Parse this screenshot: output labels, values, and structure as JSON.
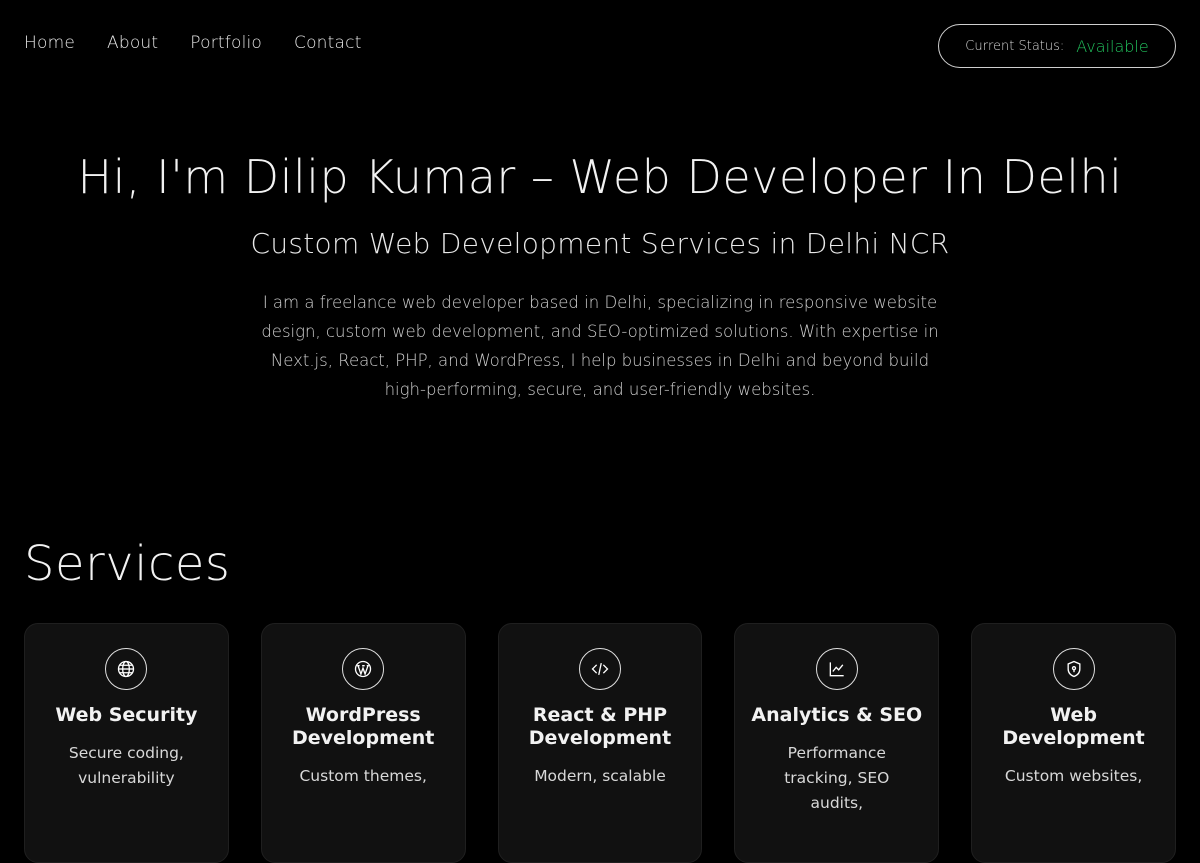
{
  "nav": {
    "links": [
      "Home",
      "About",
      "Portfolio",
      "Contact"
    ],
    "status_label": "Current Status:",
    "status_value": "Available"
  },
  "hero": {
    "title": "Hi, I'm Dilip Kumar – Web Developer In Delhi",
    "subtitle": "Custom Web Development Services in Delhi NCR",
    "description": "I am a freelance web developer based in Delhi, specializing in responsive website design, custom web development, and SEO-optimized solutions. With expertise in Next.js, React, PHP, and WordPress, I help businesses in Delhi and beyond build high-performing, secure, and user-friendly websites."
  },
  "services": {
    "title": "Services",
    "cards": [
      {
        "icon": "globe-icon",
        "title": "Web Security",
        "desc": "Secure coding, vulnerability"
      },
      {
        "icon": "wordpress-icon",
        "title": "WordPress Development",
        "desc": "Custom themes,"
      },
      {
        "icon": "code-icon",
        "title": "React & PHP Development",
        "desc": "Modern, scalable"
      },
      {
        "icon": "chart-icon",
        "title": "Analytics & SEO",
        "desc": "Performance tracking, SEO audits,"
      },
      {
        "icon": "shield-icon",
        "title": "Web Development",
        "desc": "Custom websites,"
      }
    ]
  },
  "colors": {
    "accent": "#22c55e",
    "background": "#000000",
    "card": "#111111"
  }
}
